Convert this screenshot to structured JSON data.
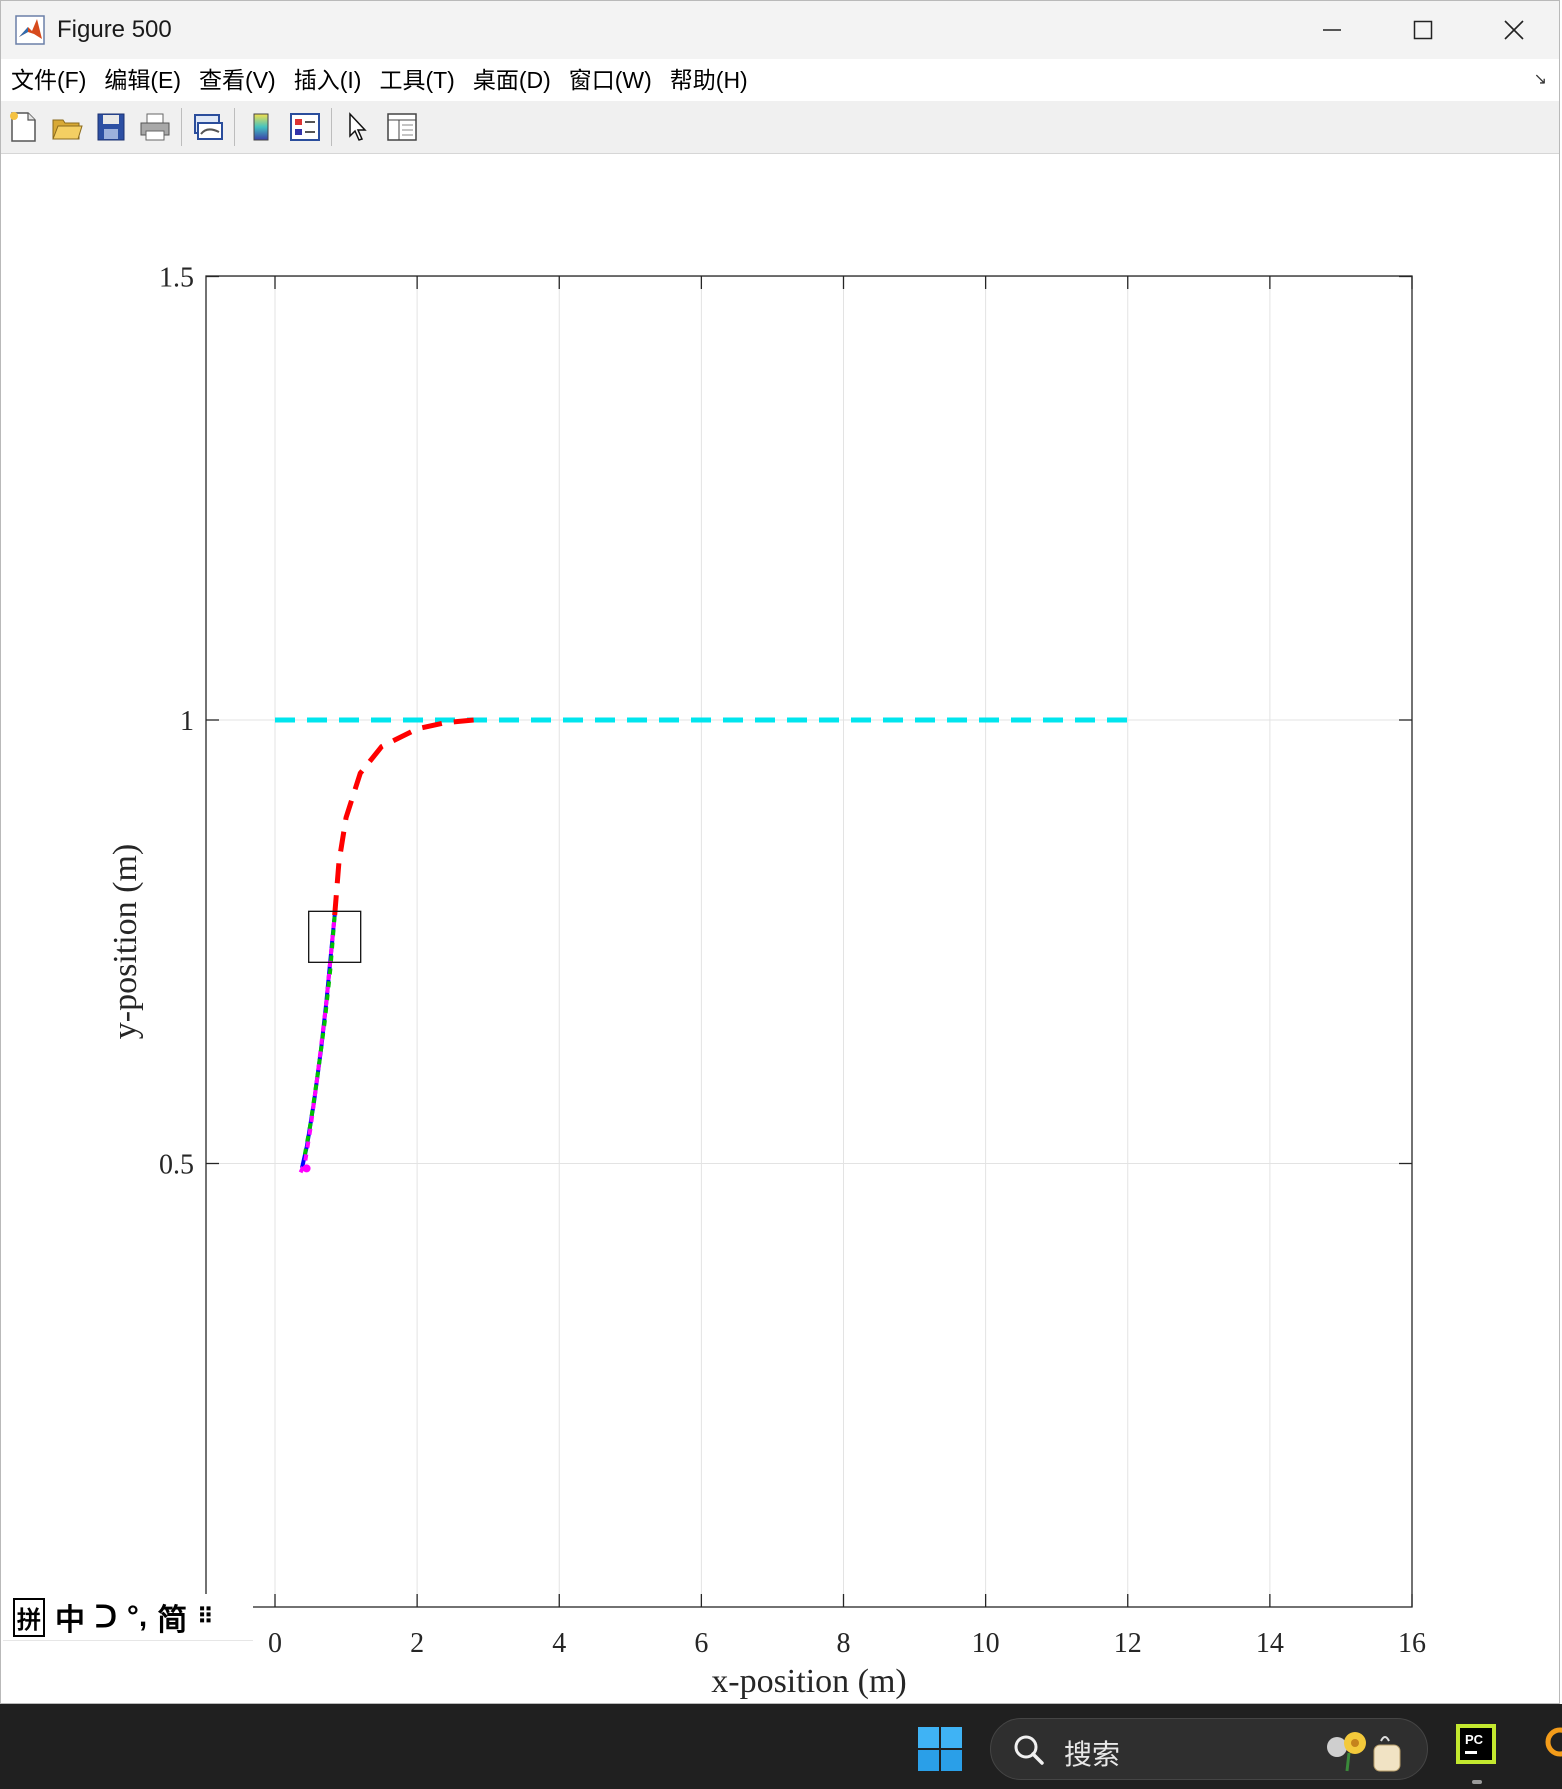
{
  "window": {
    "title": "Figure 500"
  },
  "menu": [
    "文件(F)",
    "编辑(E)",
    "查看(V)",
    "插入(I)",
    "工具(T)",
    "桌面(D)",
    "窗口(W)",
    "帮助(H)"
  ],
  "toolbar": {
    "buttons": [
      "new-figure-icon",
      "open-file-icon",
      "save-icon",
      "print-icon",
      "link-plot-icon",
      "colorbar-icon",
      "legend-icon",
      "select-arrow-icon",
      "property-inspector-icon"
    ]
  },
  "chart_data": {
    "type": "line",
    "xlabel": "x-position (m)",
    "ylabel": "y-position (m)",
    "xlim": [
      0,
      16
    ],
    "ylim": [
      0,
      1.5
    ],
    "xticks": [
      "0",
      "2",
      "4",
      "6",
      "8",
      "10",
      "12",
      "14",
      "16"
    ],
    "yticks": [
      "0.5",
      "1",
      "1.5"
    ],
    "grid": true,
    "series": [
      {
        "color": "#00e5ee",
        "style": "dashed",
        "x": [
          0,
          12
        ],
        "y": [
          1,
          1
        ]
      },
      {
        "color": "#ff0000",
        "style": "dashed",
        "x": [
          0.84,
          0.9,
          1.0,
          1.2,
          1.5,
          2.0,
          2.4,
          2.8
        ],
        "y": [
          0.78,
          0.84,
          0.89,
          0.94,
          0.97,
          0.99,
          0.997,
          1.0
        ]
      },
      {
        "color": "#0000ff",
        "style": "solid",
        "x": [
          0.38,
          0.45,
          0.55,
          0.65,
          0.72,
          0.78,
          0.84
        ],
        "y": [
          0.495,
          0.52,
          0.57,
          0.63,
          0.68,
          0.73,
          0.78
        ]
      },
      {
        "color": "#00c000",
        "style": "dotted",
        "x": [
          0.42,
          0.5,
          0.6,
          0.7,
          0.78,
          0.84
        ],
        "y": [
          0.51,
          0.545,
          0.6,
          0.66,
          0.72,
          0.78
        ]
      },
      {
        "color": "#ff00ff",
        "style": "dotted",
        "x": [
          0.36,
          0.42,
          0.5,
          0.6,
          0.72,
          0.84
        ],
        "y": [
          0.49,
          0.5,
          0.54,
          0.6,
          0.68,
          0.78
        ]
      }
    ],
    "annotations": [
      {
        "type": "rectangle",
        "center": [
          0.84,
          0.755
        ]
      }
    ]
  },
  "ime": {
    "items": [
      "拼",
      "中",
      "ᑐ",
      "°,",
      "简",
      "⠿"
    ]
  },
  "taskbar": {
    "search_placeholder": "搜索"
  }
}
